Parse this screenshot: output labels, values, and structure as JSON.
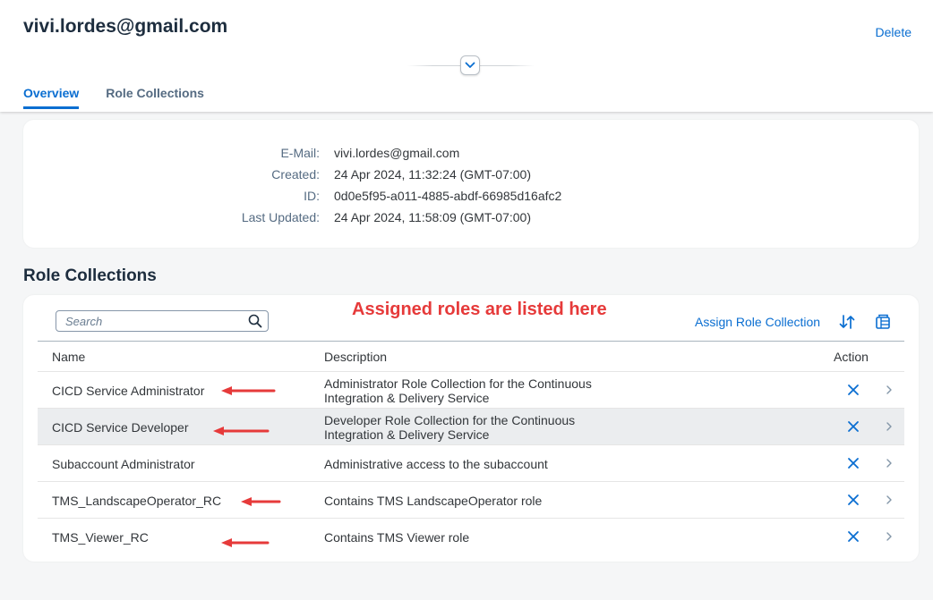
{
  "header": {
    "title": "vivi.lordes@gmail.com",
    "delete_label": "Delete",
    "tabs": [
      {
        "label": "Overview",
        "active": true
      },
      {
        "label": "Role Collections",
        "active": false
      }
    ]
  },
  "details": {
    "email": {
      "label": "E-Mail:",
      "value": "vivi.lordes@gmail.com"
    },
    "created": {
      "label": "Created:",
      "value": "24 Apr 2024, 11:32:24 (GMT-07:00)"
    },
    "id": {
      "label": "ID:",
      "value": "0d0e5f95-a011-4885-abdf-66985d16afc2"
    },
    "updated": {
      "label": "Last Updated:",
      "value": "24 Apr 2024, 11:58:09 (GMT-07:00)"
    }
  },
  "roles": {
    "section_title": "Role Collections",
    "search_placeholder": "Search",
    "annotation": "Assigned roles are listed here",
    "assign_label": "Assign Role Collection",
    "columns": {
      "name": "Name",
      "description": "Description",
      "action": "Action"
    },
    "rows": [
      {
        "name": "CICD Service Administrator",
        "description": "Administrator Role Collection for the Continuous Integration & Delivery Service"
      },
      {
        "name": "CICD Service Developer",
        "description": "Developer Role Collection for the Continuous Integration & Delivery Service"
      },
      {
        "name": "Subaccount Administrator",
        "description": "Administrative access to the subaccount"
      },
      {
        "name": "TMS_LandscapeOperator_RC",
        "description": "Contains TMS LandscapeOperator role"
      },
      {
        "name": "TMS_Viewer_RC",
        "description": "Contains TMS Viewer role"
      }
    ]
  },
  "icons": {
    "collapse": "chevron-down-icon",
    "search": "search-icon",
    "sort": "sort-icon",
    "column_settings": "table-settings-icon",
    "remove": "close-icon",
    "navigate": "chevron-right-icon",
    "annotation_arrow": "arrow-left-icon"
  },
  "colors": {
    "accent": "#0a6ed1",
    "annotation": "#e63a3a",
    "background": "#f5f6f7"
  }
}
